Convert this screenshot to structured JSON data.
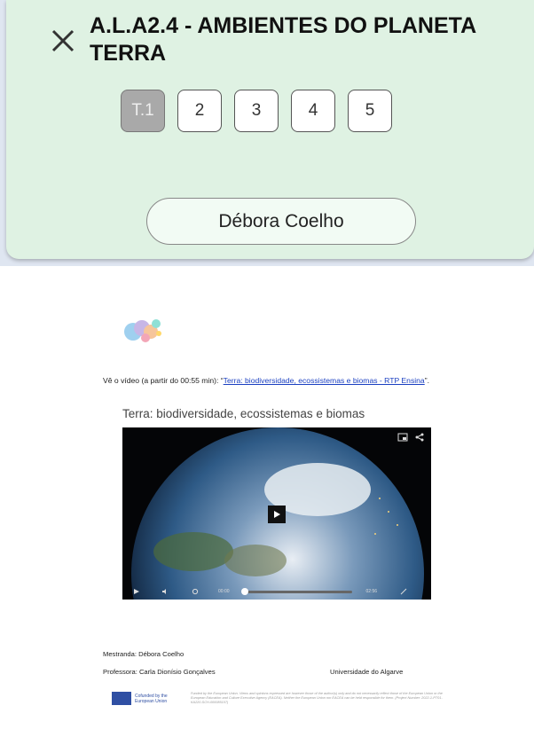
{
  "header": {
    "title": "A.L.A2.4 - AMBIENTES DO PLANETA TERRA",
    "tabs": [
      "T.1",
      "2",
      "3",
      "4",
      "5"
    ],
    "active_tab": "T.1",
    "student_name": "Débora Coelho",
    "background_color": "#dff2e3"
  },
  "document": {
    "intro_prefix": "Vê o vídeo (a partir do 00:55 min): “",
    "intro_link": "Terra: biodiversidade, ecossistemas e biomas - RTP Ensina",
    "intro_suffix": "”.",
    "video_title": "Terra: biodiversidade, ecossistemas e biomas",
    "video": {
      "time_current": "00:00",
      "time_total": "02:56"
    },
    "student_line": "Mestranda: Débora Coelho",
    "teacher_line": "Professora: Carla Dionísio Gonçalves",
    "university": "Universidade do Algarve",
    "eu_logo_text": "Cofunded by the European Union",
    "disclaimer": "Funded by the European Union. Views and opinions expressed are however those of the author(s) only and do not necessarily reflect those of the European Union or the European Education and Culture Executive Agency (EACEA). Neither the European Union nor EACEA can be held responsible for them. (Project Number: 2022-1-PT01-KA220-SCH-000085107)"
  },
  "icons": {
    "close": "close-icon",
    "play": "play-icon"
  }
}
